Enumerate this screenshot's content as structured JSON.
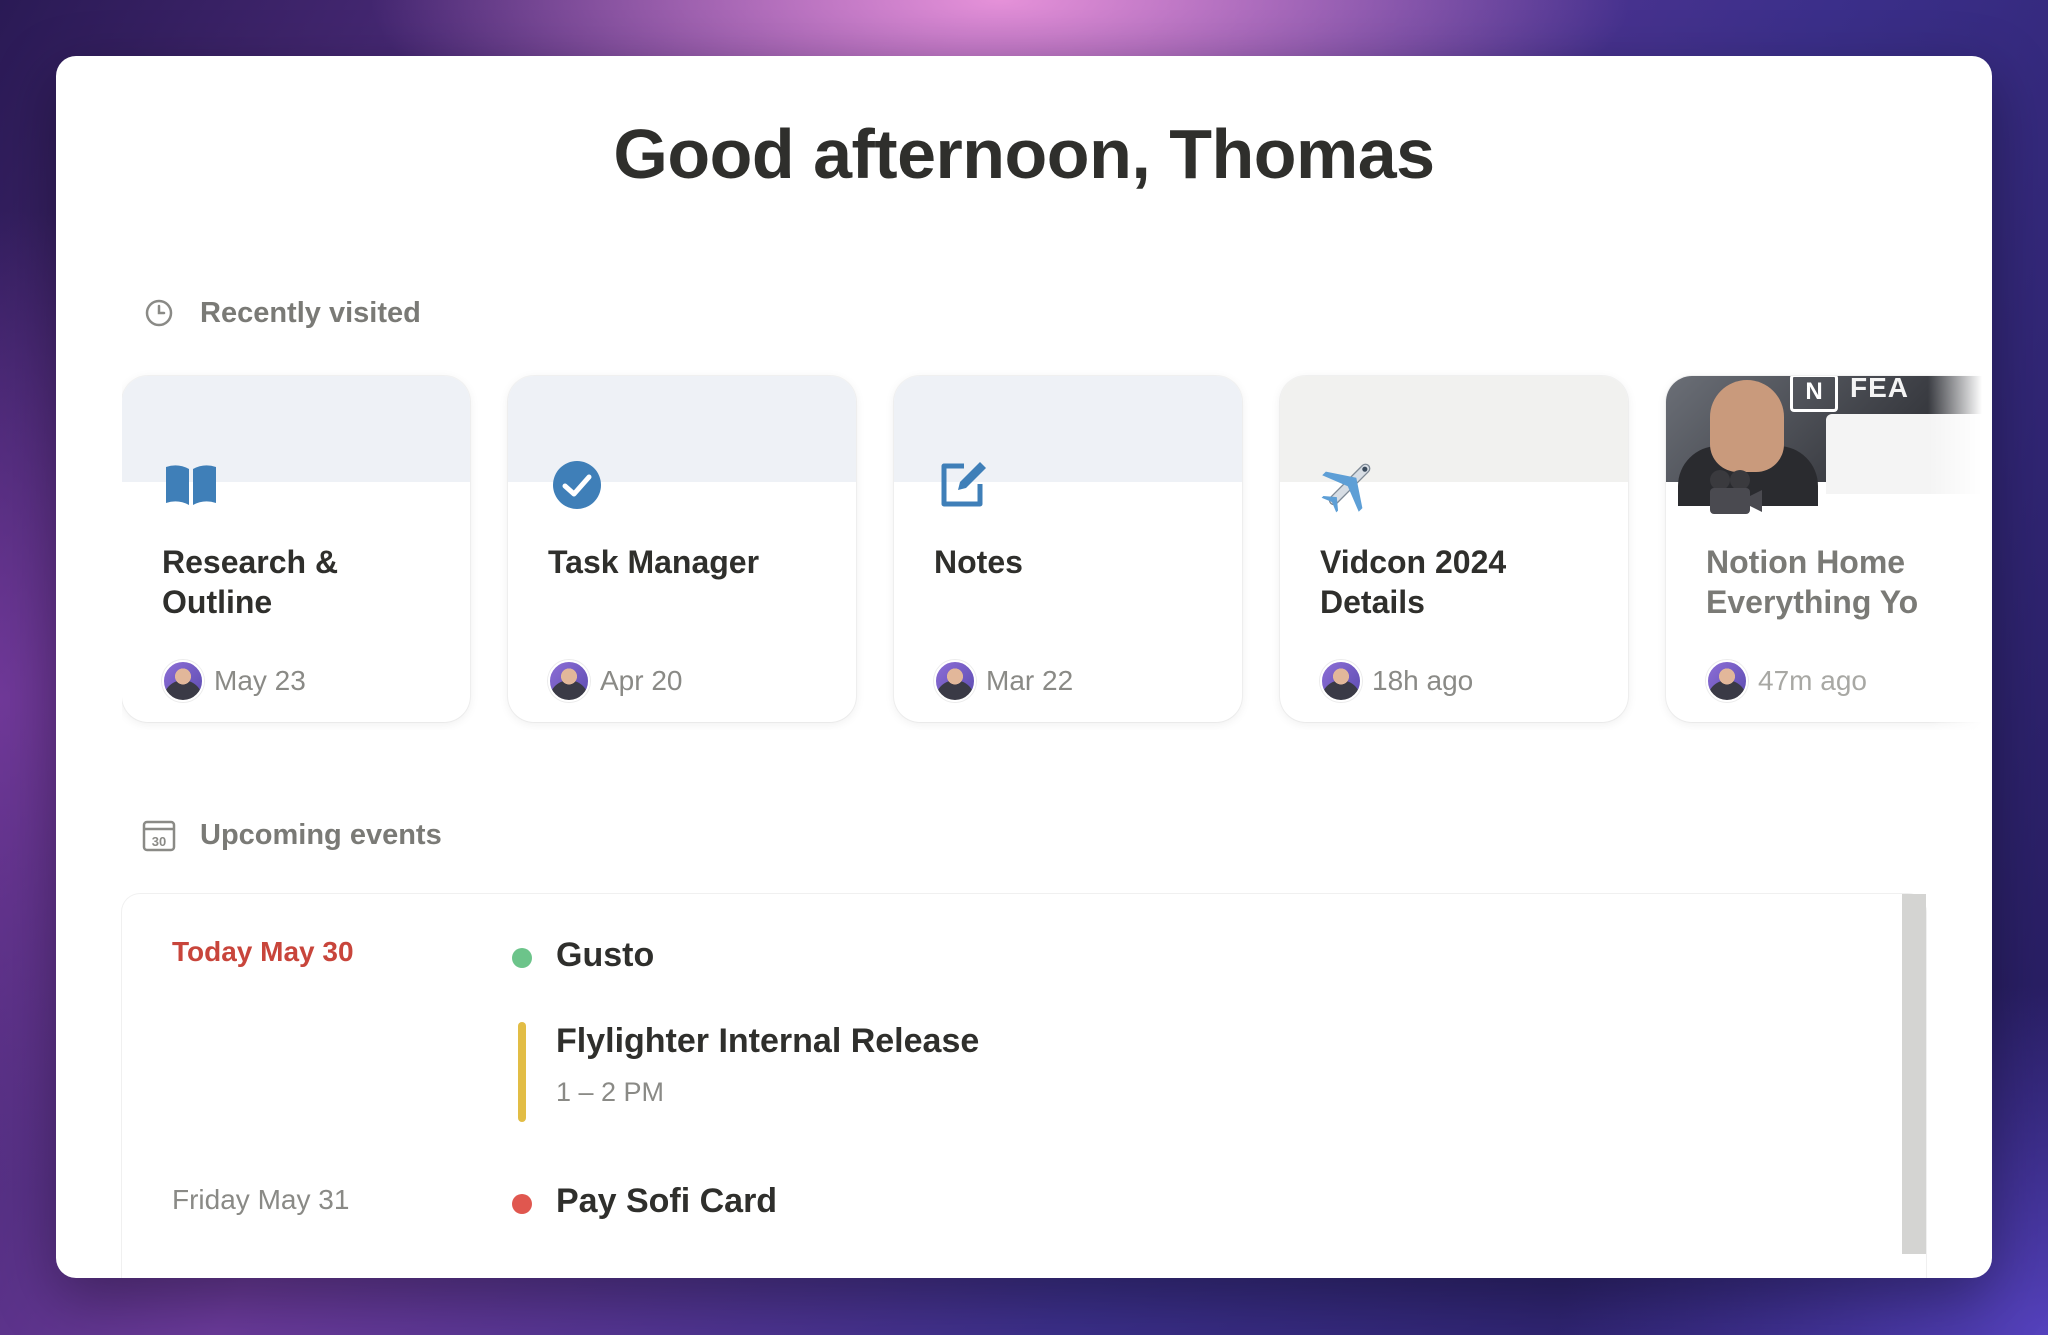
{
  "greeting": "Good afternoon, Thomas",
  "recently_visited": {
    "title": "Recently visited",
    "icon": "clock-icon",
    "cards": [
      {
        "title": "Research &\nOutline",
        "date": "May 23",
        "icon": "open-book-icon"
      },
      {
        "title": "Task Manager",
        "date": "Apr 20",
        "icon": "check-circle-icon"
      },
      {
        "title": "Notes",
        "date": "Mar 22",
        "icon": "edit-note-icon"
      },
      {
        "title": "Vidcon 2024\nDetails",
        "date": "18h ago",
        "icon": "airplane-icon"
      },
      {
        "title": "Notion Home\nEverything Yo",
        "date": "47m ago",
        "icon": "movie-camera-icon",
        "cover_text": "FEA",
        "cover_badge": "N"
      }
    ]
  },
  "upcoming_events": {
    "title": "Upcoming events",
    "icon": "calendar-icon",
    "calendar_day": "30",
    "days": [
      {
        "label": "Today May 30",
        "events": [
          {
            "title": "Gusto",
            "marker": "dot",
            "color": "#6cc48a"
          },
          {
            "title": "Flylighter Internal Release",
            "time": "1 – 2 PM",
            "marker": "bar",
            "color": "#e2bd45"
          }
        ]
      },
      {
        "label": "Friday May 31",
        "events": [
          {
            "title": "Pay Sofi Card",
            "marker": "dot",
            "color": "#e0574f"
          }
        ]
      }
    ]
  },
  "colors": {
    "today": "#c8453b",
    "accent_blue": "#3f7fb8"
  }
}
